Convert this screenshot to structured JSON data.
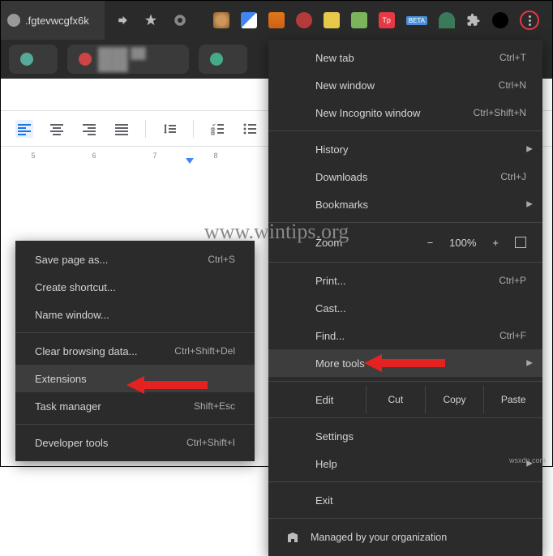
{
  "address_bar": {
    "url_fragment": ".fgtevwcgfx6k"
  },
  "main_menu": {
    "new_tab": {
      "label": "New tab",
      "shortcut": "Ctrl+T"
    },
    "new_window": {
      "label": "New window",
      "shortcut": "Ctrl+N"
    },
    "incognito": {
      "label": "New Incognito window",
      "shortcut": "Ctrl+Shift+N"
    },
    "history": {
      "label": "History"
    },
    "downloads": {
      "label": "Downloads",
      "shortcut": "Ctrl+J"
    },
    "bookmarks": {
      "label": "Bookmarks"
    },
    "zoom": {
      "label": "Zoom",
      "value": "100%",
      "minus": "−",
      "plus": "+"
    },
    "print": {
      "label": "Print...",
      "shortcut": "Ctrl+P"
    },
    "cast": {
      "label": "Cast..."
    },
    "find": {
      "label": "Find...",
      "shortcut": "Ctrl+F"
    },
    "more_tools": {
      "label": "More tools"
    },
    "edit": {
      "label": "Edit",
      "cut": "Cut",
      "copy": "Copy",
      "paste": "Paste"
    },
    "settings": {
      "label": "Settings"
    },
    "help": {
      "label": "Help"
    },
    "exit": {
      "label": "Exit"
    },
    "managed": {
      "label": "Managed by your organization"
    }
  },
  "sub_menu": {
    "save_page": {
      "label": "Save page as...",
      "shortcut": "Ctrl+S"
    },
    "create_shortcut": {
      "label": "Create shortcut..."
    },
    "name_window": {
      "label": "Name window..."
    },
    "clear_browsing": {
      "label": "Clear browsing data...",
      "shortcut": "Ctrl+Shift+Del"
    },
    "extensions": {
      "label": "Extensions"
    },
    "task_manager": {
      "label": "Task manager",
      "shortcut": "Shift+Esc"
    },
    "developer_tools": {
      "label": "Developer tools",
      "shortcut": "Ctrl+Shift+I"
    }
  },
  "ruler": {
    "marks": [
      "5",
      "6",
      "7",
      "8"
    ]
  },
  "watermark": "www.wintips.org",
  "footer": "wsxdn.com"
}
